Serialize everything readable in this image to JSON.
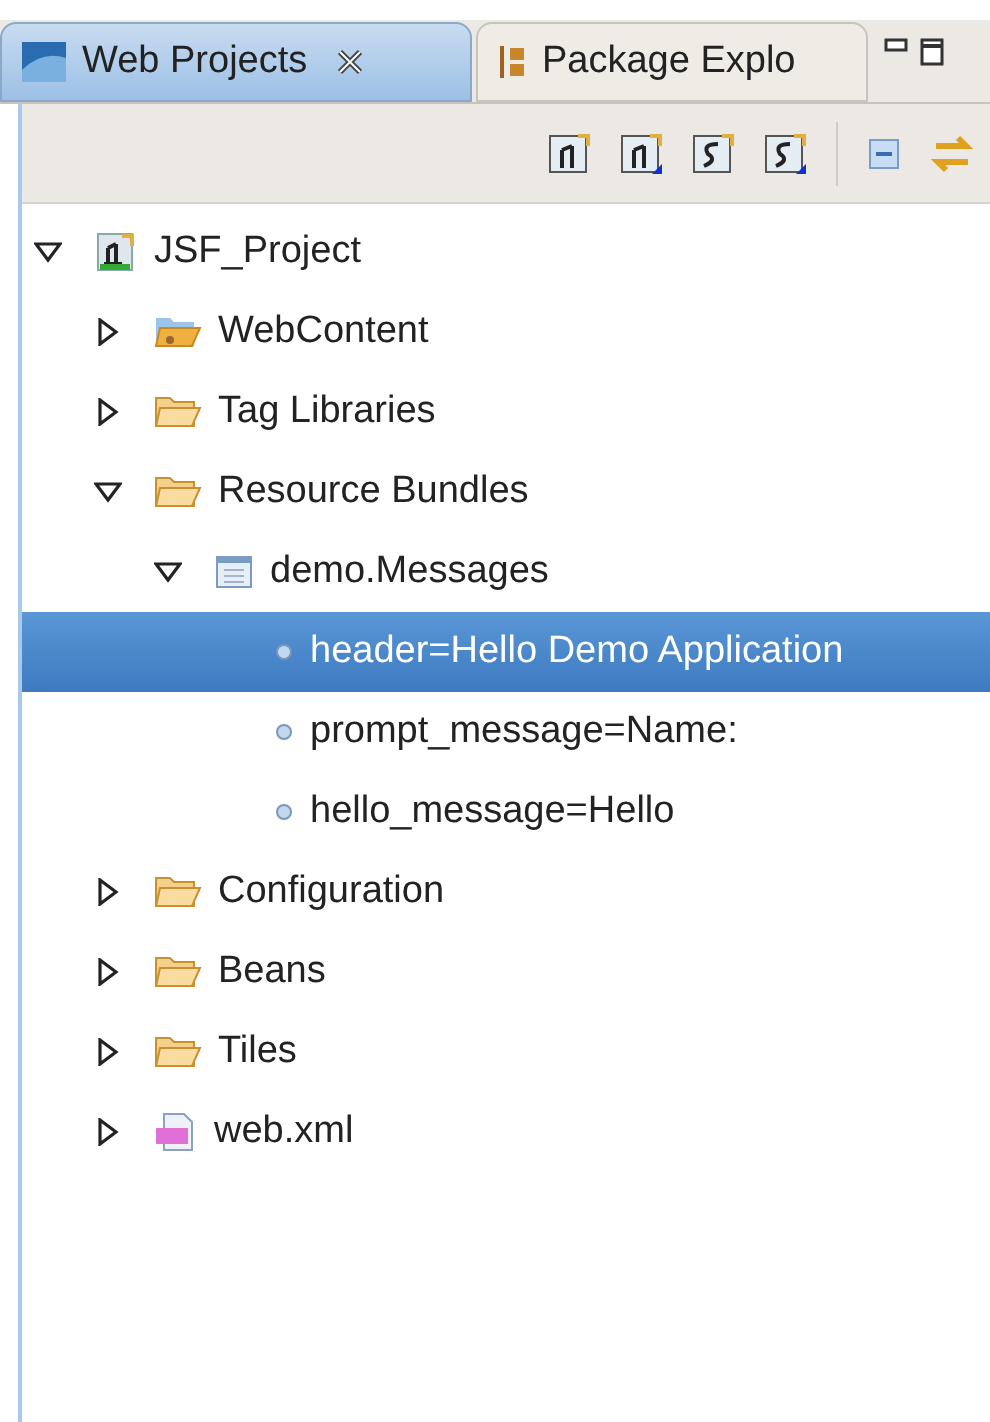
{
  "tabs": [
    {
      "label": "Web Projects",
      "selected": true,
      "closable": true
    },
    {
      "label": "Package Explo",
      "selected": false,
      "closable": false
    }
  ],
  "tree": [
    {
      "label": "JSF_Project",
      "kind": "project",
      "expanded": true,
      "selected": false,
      "children": [
        {
          "label": "WebContent",
          "kind": "webfolder",
          "expanded": false,
          "selected": false
        },
        {
          "label": "Tag Libraries",
          "kind": "folder",
          "expanded": false,
          "selected": false
        },
        {
          "label": "Resource Bundles",
          "kind": "folder",
          "expanded": true,
          "selected": false,
          "children": [
            {
              "label": "demo.Messages",
              "kind": "bundle",
              "expanded": true,
              "selected": false,
              "children": [
                {
                  "label": "header=Hello Demo Application",
                  "kind": "property",
                  "selected": true
                },
                {
                  "label": "prompt_message=Name:",
                  "kind": "property",
                  "selected": false
                },
                {
                  "label": "hello_message=Hello",
                  "kind": "property",
                  "selected": false
                }
              ]
            }
          ]
        },
        {
          "label": "Configuration",
          "kind": "folder",
          "expanded": false,
          "selected": false
        },
        {
          "label": "Beans",
          "kind": "folder",
          "expanded": false,
          "selected": false
        },
        {
          "label": "Tiles",
          "kind": "folder",
          "expanded": false,
          "selected": false
        },
        {
          "label": "web.xml",
          "kind": "xml",
          "expanded": false,
          "selected": false
        }
      ]
    }
  ]
}
